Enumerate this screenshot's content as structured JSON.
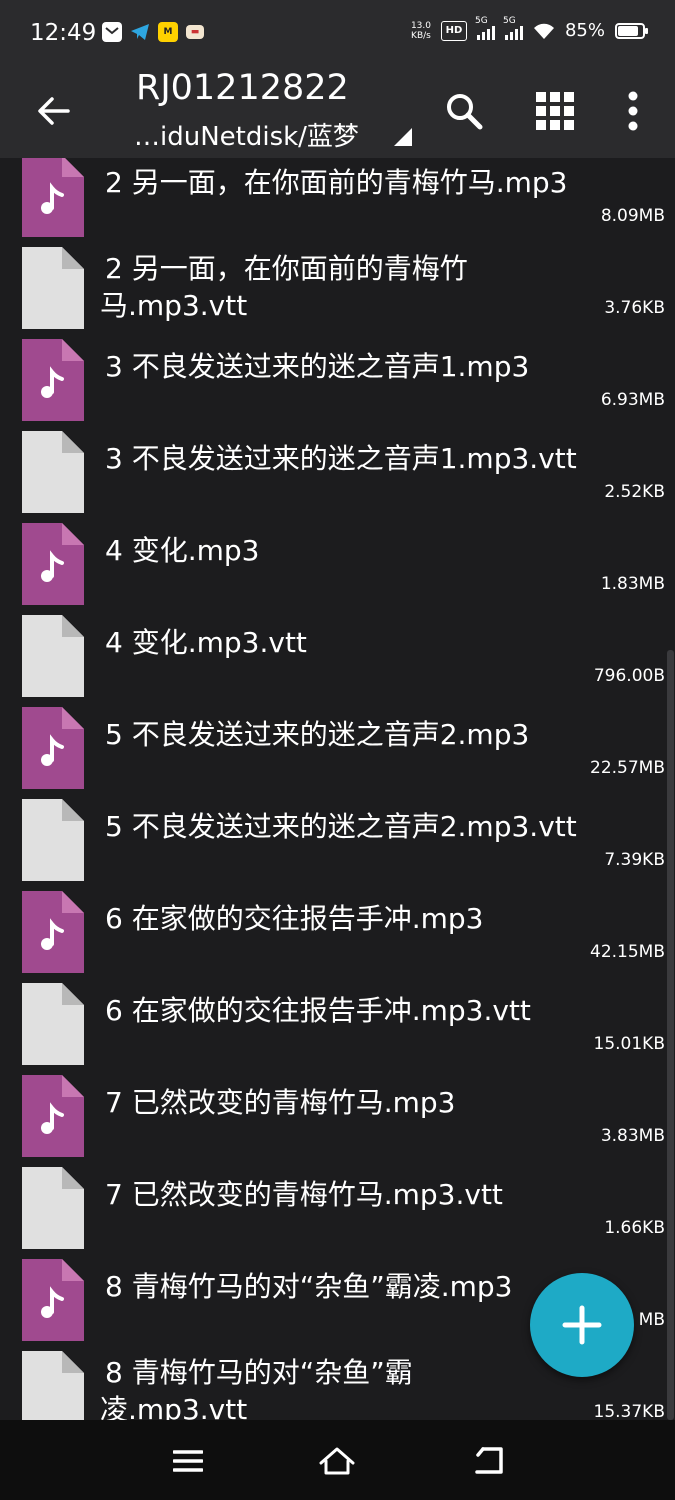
{
  "status_bar": {
    "time": "12:49",
    "net_speed_value": "13.0",
    "net_speed_unit": "KB/s",
    "hd_badge": "HD",
    "signal1_label": "5G",
    "signal2_label": "5G",
    "battery_percent": "85%",
    "battery_level": 0.85
  },
  "app_bar": {
    "title": "RJ01212822",
    "path": "…iduNetdisk/蓝梦",
    "icons": [
      "back-arrow-icon",
      "search-icon",
      "grid-view-icon",
      "more-vertical-icon"
    ]
  },
  "colors": {
    "audio_icon": "#a04a8f",
    "audio_icon_fold": "#c877b2",
    "doc_icon": "#e0e0e0",
    "doc_icon_fold": "#b8b8b8",
    "fab": "#1eaac6",
    "background": "#1c1c1e",
    "bar": "#2b2b2d"
  },
  "files": [
    {
      "name": "2 另一面，在你面前的青梅竹马.mp3",
      "size": "8.09MB",
      "type": "audio"
    },
    {
      "name": "2 另一面，在你面前的青梅竹马.mp3.vtt",
      "size": "3.76KB",
      "type": "doc",
      "line1": "2 另一面，在你面前的青梅竹",
      "line2": "马.mp3.vtt"
    },
    {
      "name": "3 不良发送过来的迷之音声1.mp3",
      "size": "6.93MB",
      "type": "audio"
    },
    {
      "name": "3 不良发送过来的迷之音声1.mp3.vtt",
      "size": "2.52KB",
      "type": "doc"
    },
    {
      "name": "4 变化.mp3",
      "size": "1.83MB",
      "type": "audio"
    },
    {
      "name": "4 变化.mp3.vtt",
      "size": "796.00B",
      "type": "doc"
    },
    {
      "name": "5 不良发送过来的迷之音声2.mp3",
      "size": "22.57MB",
      "type": "audio"
    },
    {
      "name": "5 不良发送过来的迷之音声2.mp3.vtt",
      "size": "7.39KB",
      "type": "doc"
    },
    {
      "name": "6 在家做的交往报告手冲.mp3",
      "size": "42.15MB",
      "type": "audio"
    },
    {
      "name": "6 在家做的交往报告手冲.mp3.vtt",
      "size": "15.01KB",
      "type": "doc"
    },
    {
      "name": "7 已然改变的青梅竹马.mp3",
      "size": "3.83MB",
      "type": "audio"
    },
    {
      "name": "7 已然改变的青梅竹马.mp3.vtt",
      "size": "1.66KB",
      "type": "doc"
    },
    {
      "name": "8 青梅竹马的对“杂鱼”霸凌.mp3",
      "size": "MB",
      "type": "audio"
    },
    {
      "name": "8 青梅竹马的对“杂鱼”霸凌.mp3.vtt",
      "size": "15.37KB",
      "type": "doc",
      "line1": "8 青梅竹马的对“杂鱼”霸",
      "line2": "凌.mp3.vtt"
    }
  ],
  "fab": {
    "icon": "plus-icon"
  },
  "nav_bar": {
    "icons": [
      "menu-icon",
      "home-icon",
      "back-icon"
    ]
  }
}
